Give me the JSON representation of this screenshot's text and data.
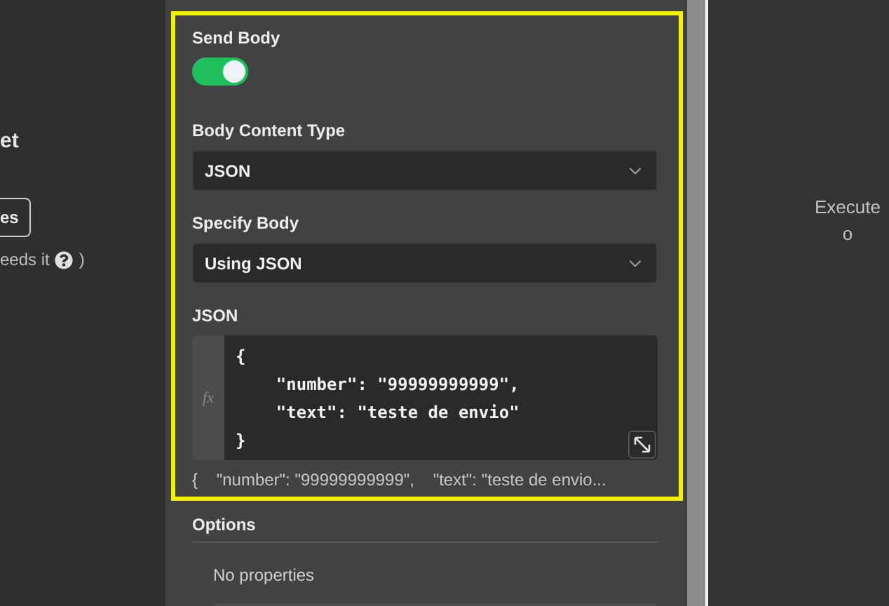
{
  "left_panel": {
    "heading": "et",
    "button": "es",
    "hint": "eeds it",
    "hint_end": ")"
  },
  "body_settings": {
    "send_body": {
      "label": "Send Body",
      "on": true
    },
    "content_type": {
      "label": "Body Content Type",
      "value": "JSON"
    },
    "specify_body": {
      "label": "Specify Body",
      "value": "Using JSON"
    },
    "json": {
      "label": "JSON",
      "gutter": "fx",
      "code_lines": [
        "{",
        "    \"number\": \"99999999999\",",
        "    \"text\": \"teste de envio\"",
        "}"
      ],
      "preview": "{    \"number\": \"99999999999\",    \"text\": \"teste de envio..."
    }
  },
  "options": {
    "title": "Options",
    "empty_text": "No properties"
  },
  "output_panel": {
    "lines": [
      "Execute",
      "o"
    ]
  }
}
